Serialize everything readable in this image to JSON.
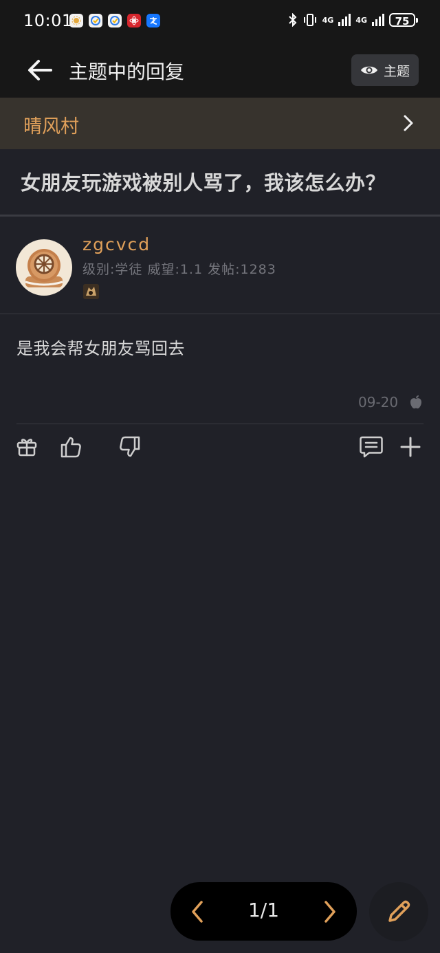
{
  "status_bar": {
    "time": "10:01",
    "network_1": "4G",
    "network_2": "4G",
    "battery": "75",
    "app_icons": [
      "sun-app-icon",
      "check-app-icon",
      "check-app-icon",
      "red-app-icon",
      "alipay-icon"
    ]
  },
  "header": {
    "title": "主题中的回复",
    "topic_button_label": "主题"
  },
  "board": {
    "name": "晴风村"
  },
  "topic": {
    "title": "女朋友玩游戏被别人骂了，我该怎么办？"
  },
  "user": {
    "name": "zgcvcd",
    "meta": "级别:学徒 威望:1.1 发帖:1283"
  },
  "post": {
    "body": "是我会帮女朋友骂回去",
    "date": "09-20"
  },
  "pager": {
    "page": "1/1"
  },
  "colors": {
    "accent": "#e0a05a",
    "background": "#202128",
    "bar": "#171717",
    "board_row": "#37332d"
  }
}
